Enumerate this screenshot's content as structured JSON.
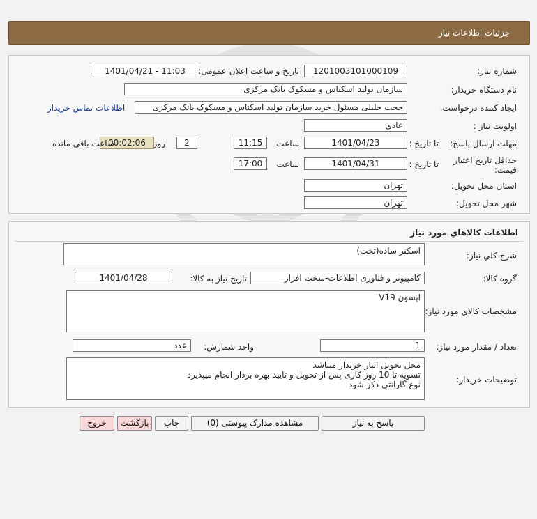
{
  "header": {
    "title": "جزئیات اطلاعات نیاز"
  },
  "info": {
    "need_number_label": "شماره نیاز:",
    "need_number": "1201003101000109",
    "announce_label": "تاریخ و ساعت اعلان عمومی:",
    "announce_value": "1401/04/21 - 11:03",
    "buyer_org_label": "نام دستگاه خریدار:",
    "buyer_org": "سازمان تولید اسکناس و مسکوک بانک مرکزی",
    "creator_label": "ایجاد کننده درخواست:",
    "creator": "حجت جلیلی مسئول خرید سازمان تولید اسکناس و مسکوک بانک مرکزی",
    "contact_link": "اطلاعات تماس خریدار",
    "priority_label": "اولویت نیاز :",
    "priority": "عادي",
    "deadline_label": "مهلت ارسال پاسخ:",
    "to_date_label": "تا تاریخ :",
    "deadline_date": "1401/04/23",
    "time_label": "ساعت",
    "deadline_time": "11:15",
    "days_value": "2",
    "days_label": "روز و",
    "remaining_time": "00:02:06",
    "remaining_label": "ساعت باقی مانده",
    "validity_label_1": "حداقل تاریخ اعتبار",
    "validity_label_2": "قیمت:",
    "validity_to_label": "تا تاریخ :",
    "validity_date": "1401/04/31",
    "validity_time_label": "ساعت",
    "validity_time": "17:00",
    "province_label": "استان محل تحویل:",
    "province": "تهران",
    "city_label": "شهر محل تحویل:",
    "city": "تهران"
  },
  "goods": {
    "section_title": "اطلاعات کالاهاي مورد نياز",
    "general_desc_label": "شرح کلي نياز:",
    "general_desc": "اسکنر ساده(تخت)",
    "group_label": "گروه کالا:",
    "group": "کامپیوتر و فناوری اطلاعات-سخت افزار",
    "need_date_label": "تاریخ نیاز به کالا:",
    "need_date": "1401/04/28",
    "specs_label": "مشخصات کالاي مورد نياز:",
    "specs": "اپسون V19",
    "qty_label": "تعداد / مقدار مورد نیاز:",
    "qty": "1",
    "unit_label": "واحد شمارش:",
    "unit": "عدد",
    "buyer_notes_label": "توضیحات خریدار:",
    "buyer_notes_lines": [
      "محل تحویل انبار خریدار میباشد",
      "تسویه تا 10 روز کاری پس از تحویل و تایید بهره بردار انجام میپذیرد",
      "نوع گارانتی ذکر شود"
    ]
  },
  "buttons": {
    "reply": "پاسخ به نیاز",
    "attachments": "مشاهده مدارک پیوستی (0)",
    "print": "چاپ",
    "back": "بازگشت",
    "exit": "خروج"
  },
  "colors": {
    "header_bg": "#8c6a43",
    "link": "#1a3f9a",
    "remaining_bg": "#e8e2c2",
    "exit_bg": "#f8d8d8"
  }
}
